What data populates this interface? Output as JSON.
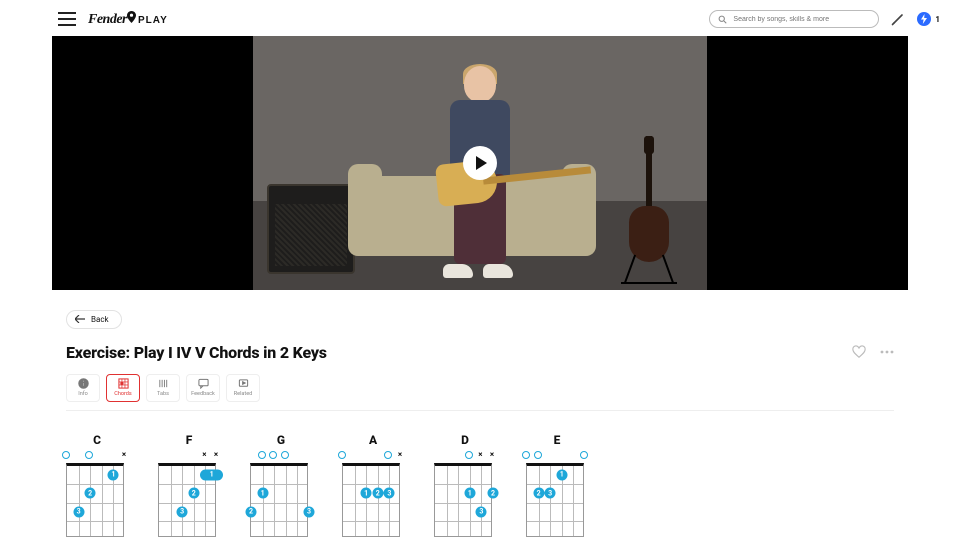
{
  "header": {
    "logo_text_1": "Fender",
    "logo_text_2": "PLAY",
    "search_placeholder": "Search by songs, skills & more",
    "streak_count": "1"
  },
  "back_label": "Back",
  "lesson_title": "Exercise: Play I IV V Chords in 2 Keys",
  "tabs": {
    "info": "Info",
    "chords": "Chords",
    "tabs": "Tabs",
    "feedback": "Feedback",
    "related": "Related"
  },
  "colors": {
    "accent_red": "#e03131",
    "accent_blue": "#1ea7d9",
    "bolt_blue": "#2b6bff"
  },
  "chords": [
    {
      "name": "C",
      "top": [
        "x",
        null,
        null,
        "o",
        null,
        "o"
      ],
      "dots": [
        {
          "s": 1,
          "f": 1,
          "finger": "1"
        },
        {
          "s": 3,
          "f": 2,
          "finger": "2"
        },
        {
          "s": 4,
          "f": 3,
          "finger": "3"
        }
      ]
    },
    {
      "name": "F",
      "top": [
        "x",
        "x",
        null,
        null,
        null,
        null
      ],
      "barres": [
        {
          "from": 0,
          "to": 1,
          "f": 1,
          "finger": "1"
        }
      ],
      "dots": [
        {
          "s": 2,
          "f": 2,
          "finger": "2"
        },
        {
          "s": 3,
          "f": 3,
          "finger": "3"
        }
      ]
    },
    {
      "name": "G",
      "top": [
        null,
        null,
        "o",
        "o",
        "o",
        null
      ],
      "dots": [
        {
          "s": 4,
          "f": 2,
          "finger": "1"
        },
        {
          "s": 5,
          "f": 3,
          "finger": "2"
        },
        {
          "s": 0,
          "f": 3,
          "finger": "3"
        }
      ]
    },
    {
      "name": "A",
      "top": [
        "x",
        "o",
        null,
        null,
        null,
        "o"
      ],
      "dots": [
        {
          "s": 3,
          "f": 2,
          "finger": "1"
        },
        {
          "s": 2,
          "f": 2,
          "finger": "2"
        },
        {
          "s": 1,
          "f": 2,
          "finger": "3"
        }
      ]
    },
    {
      "name": "D",
      "top": [
        "x",
        "x",
        "o",
        null,
        null,
        null
      ],
      "dots": [
        {
          "s": 2,
          "f": 2,
          "finger": "1"
        },
        {
          "s": 0,
          "f": 2,
          "finger": "2"
        },
        {
          "s": 1,
          "f": 3,
          "finger": "3"
        }
      ]
    },
    {
      "name": "E",
      "top": [
        "o",
        null,
        null,
        null,
        "o",
        "o"
      ],
      "dots": [
        {
          "s": 2,
          "f": 1,
          "finger": "1"
        },
        {
          "s": 4,
          "f": 2,
          "finger": "2"
        },
        {
          "s": 3,
          "f": 2,
          "finger": "3"
        }
      ]
    }
  ]
}
